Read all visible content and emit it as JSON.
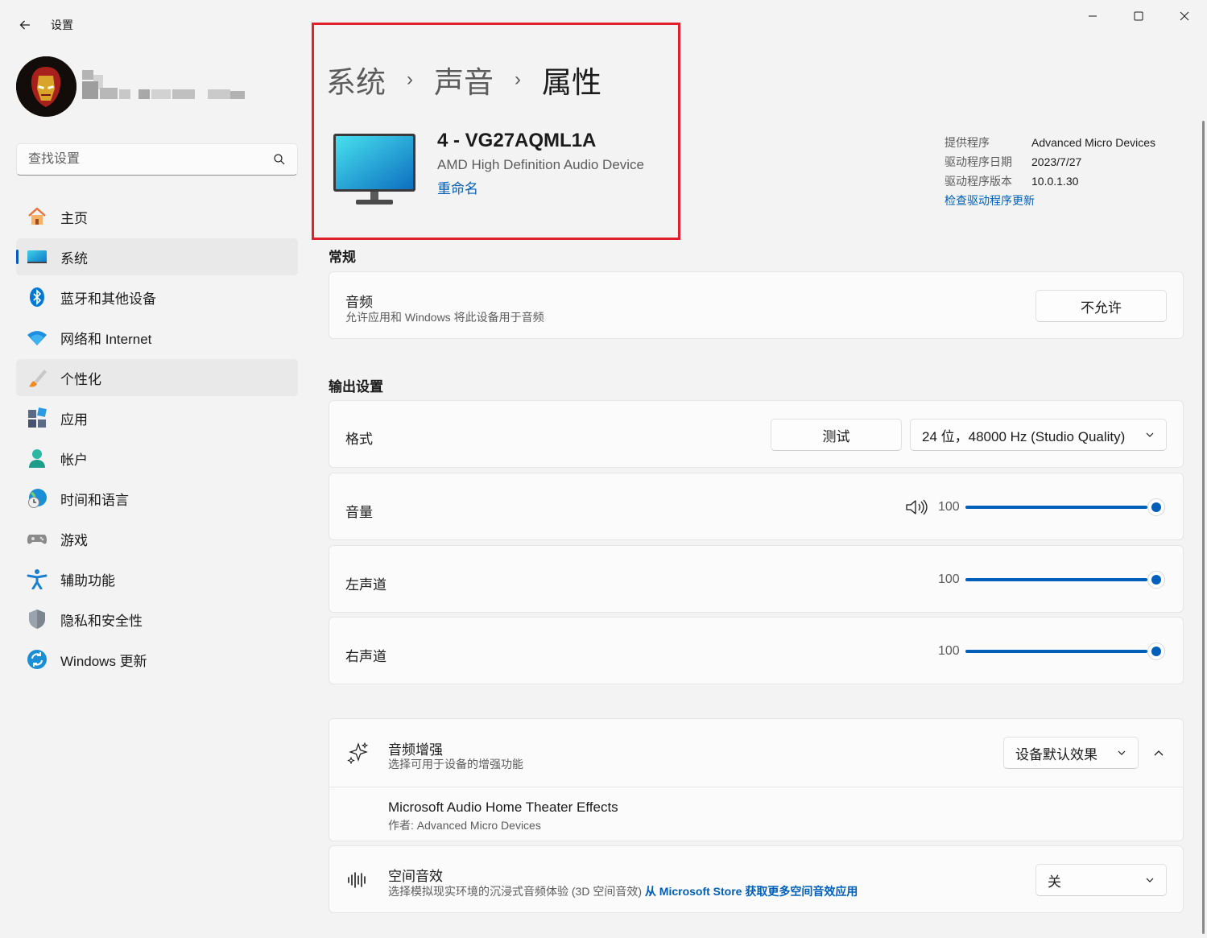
{
  "titlebar": {
    "app_title": "设置"
  },
  "search": {
    "placeholder": "查找设置"
  },
  "sidebar": {
    "items": [
      {
        "label": "主页"
      },
      {
        "label": "系统"
      },
      {
        "label": "蓝牙和其他设备"
      },
      {
        "label": "网络和 Internet"
      },
      {
        "label": "个性化"
      },
      {
        "label": "应用"
      },
      {
        "label": "帐户"
      },
      {
        "label": "时间和语言"
      },
      {
        "label": "游戏"
      },
      {
        "label": "辅助功能"
      },
      {
        "label": "隐私和安全性"
      },
      {
        "label": "Windows 更新"
      }
    ],
    "active_index": 1
  },
  "breadcrumb": {
    "level1": "系统",
    "level2": "声音",
    "current": "属性"
  },
  "device": {
    "name": "4 - VG27AQML1A",
    "description": "AMD High Definition Audio Device",
    "rename": "重命名"
  },
  "driver": {
    "provider_label": "提供程序",
    "provider_value": "Advanced Micro Devices",
    "date_label": "驱动程序日期",
    "date_value": "2023/7/27",
    "version_label": "驱动程序版本",
    "version_value": "10.0.1.30",
    "update_link": "检查驱动程序更新"
  },
  "general": {
    "title": "常规",
    "audio_title": "音频",
    "audio_sub": "允许应用和 Windows 将此设备用于音频",
    "audio_button": "不允许"
  },
  "output": {
    "title": "输出设置",
    "format_label": "格式",
    "test_button": "测试",
    "format_value": "24 位，48000 Hz (Studio Quality)",
    "volume_label": "音量",
    "volume_value": "100",
    "left_label": "左声道",
    "left_value": "100",
    "right_label": "右声道",
    "right_value": "100"
  },
  "enhance": {
    "title": "音频增强",
    "sub": "选择可用于设备的增强功能",
    "dropdown": "设备默认效果",
    "effect_name": "Microsoft Audio Home Theater Effects",
    "effect_author": "作者: Advanced Micro Devices"
  },
  "spatial": {
    "title": "空间音效",
    "sub": "选择模拟现实环境的沉浸式音频体验 (3D 空间音效)",
    "link": "从 Microsoft Store 获取更多空间音效应用",
    "dropdown": "关"
  },
  "colors": {
    "accent": "#005fb8",
    "highlight_box": "#e0202a"
  }
}
